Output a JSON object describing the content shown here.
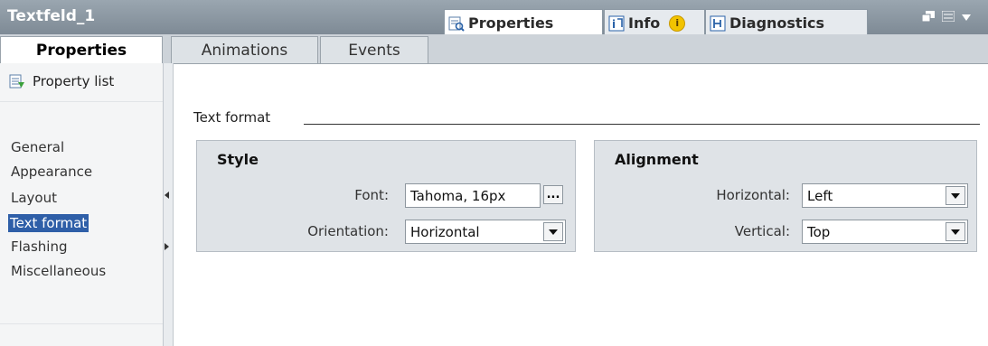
{
  "window": {
    "title": "Textfeld_1"
  },
  "panel_tabs": [
    {
      "label": "Properties",
      "active": true
    },
    {
      "label": "Info",
      "badge": "i"
    },
    {
      "label": "Diagnostics"
    }
  ],
  "sub_tabs": [
    {
      "label": "Properties",
      "active": true
    },
    {
      "label": "Animations"
    },
    {
      "label": "Events"
    }
  ],
  "sidebar": {
    "property_list": "Property list",
    "items": [
      "General",
      "Appearance",
      "Layout",
      "Text format",
      "Flashing",
      "Miscellaneous"
    ],
    "selected": "Text format"
  },
  "content": {
    "section_title": "Text format",
    "style": {
      "title": "Style",
      "font_label": "Font:",
      "font_value": "Tahoma, 16px",
      "font_button": "...",
      "orientation_label": "Orientation:",
      "orientation_value": "Horizontal"
    },
    "alignment": {
      "title": "Alignment",
      "horizontal_label": "Horizontal:",
      "horizontal_value": "Left",
      "vertical_label": "Vertical:",
      "vertical_value": "Top"
    }
  },
  "colors": {
    "titlebar": "#8a96a1",
    "selection": "#2f5fa8",
    "group_bg": "#dfe3e7"
  }
}
